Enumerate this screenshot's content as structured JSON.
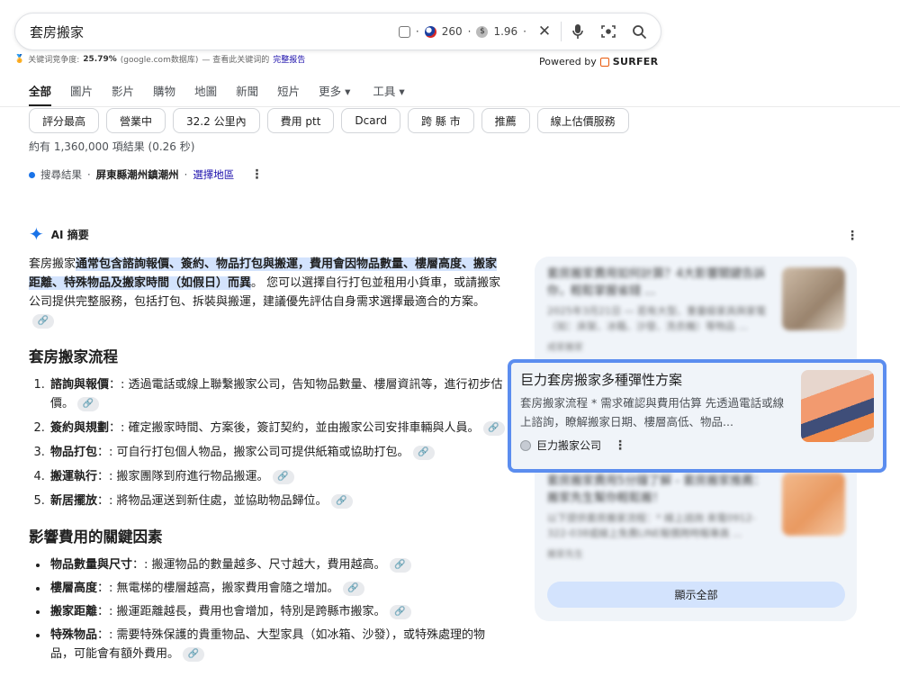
{
  "search": {
    "query": "套房搬家",
    "volume": "260",
    "cpc": "1.96",
    "sep": "·"
  },
  "keyword_line": {
    "label": "关键词竞争度:",
    "value": "25.79%",
    "source": "(google.com数据库)",
    "mid": "— 查看此关键词的",
    "link": "完整报告"
  },
  "powered": {
    "prefix": "Powered by",
    "brand": "SURFER"
  },
  "tabs": [
    "全部",
    "圖片",
    "影片",
    "購物",
    "地圖",
    "新聞",
    "短片",
    "更多 ▾",
    "工具 ▾"
  ],
  "chips": [
    "評分最高",
    "營業中",
    "32.2 公里內",
    "費用 ptt",
    "Dcard",
    "跨 縣 市",
    "推薦",
    "線上估價服務"
  ],
  "result_count": "約有 1,360,000 項結果 (0.26 秒)",
  "location": {
    "label": "搜尋結果",
    "dot": "·",
    "place": "屏東縣潮州鎮潮州",
    "link": "選擇地區"
  },
  "ai": {
    "title": "AI 摘要",
    "intro_plain": "套房搬家",
    "intro_hl": "通常包含諮詢報價、簽約、物品打包與搬運，費用會因物品數量、樓層高度、搬家距離、特殊物品及搬家時間（如假日）而異",
    "intro_rest": "。 您可以選擇自行打包並租用小貨車，或請搬家公司提供完整服務，包括打包、拆裝與搬運，建議優先評估自身需求選擇最適合的方案。",
    "section1": "套房搬家流程",
    "steps": [
      {
        "b": "諮詢與報價",
        "t": "：: 透過電話或線上聯繫搬家公司，告知物品數量、樓層資訊等，進行初步估價。"
      },
      {
        "b": "簽約與規劃",
        "t": "：: 確定搬家時間、方案後，簽訂契約，並由搬家公司安排車輛與人員。"
      },
      {
        "b": "物品打包",
        "t": "：: 可自行打包個人物品，搬家公司可提供紙箱或協助打包。"
      },
      {
        "b": "搬運執行",
        "t": "：: 搬家團隊到府進行物品搬運。"
      },
      {
        "b": "新居擺放",
        "t": "：: 將物品運送到新住處，並協助物品歸位。"
      }
    ],
    "section2": "影響費用的關鍵因素",
    "factors": [
      {
        "b": "物品數量與尺寸",
        "t": "：: 搬運物品的數量越多、尺寸越大，費用越高。"
      },
      {
        "b": "樓層高度",
        "t": "：: 無電梯的樓層越高，搬家費用會隨之增加。"
      },
      {
        "b": "搬家距離",
        "t": "：: 搬運距離越長，費用也會增加，特別是跨縣市搬家。"
      },
      {
        "b": "特殊物品",
        "t": "：: 需要特殊保護的貴重物品、大型家具（如冰箱、沙發），或特殊處理的物品，可能會有額外費用。"
      }
    ]
  },
  "side": {
    "card1": {
      "title": "套房搬家費用如何計算？4大影響關鍵告訴你，輕鬆掌握省錢 ...",
      "desc": "2025年3月21日 — 若有大型、重量級家具與家電（如：床架、冰箱、沙發、洗衣機）等物品 ...",
      "source": "成家搬家"
    },
    "card2": {
      "title": "巨力套房搬家多種彈性方案",
      "desc": "套房搬家流程 * 需求確認與費用估算 先透過電話或線上諮詢，瞭解搬家日期、樓層高低、物品...",
      "source": "巨力搬家公司"
    },
    "card3": {
      "title": "套房搬家費用5分鐘了解 - 套房搬家推薦：搬家先生幫你輕鬆搬！",
      "desc": "以下提供套房搬家流程：* 線上諮詢 來電0912-322-038或線上免費LINE報價跨時報專員 ...",
      "source": "搬家先生"
    },
    "show_all": "顯示全部"
  },
  "colors": {
    "accent": "#1a73e8",
    "highlight": "#d3e3fd",
    "panel": "#f0f4f9",
    "focus_border": "#5b8def"
  }
}
